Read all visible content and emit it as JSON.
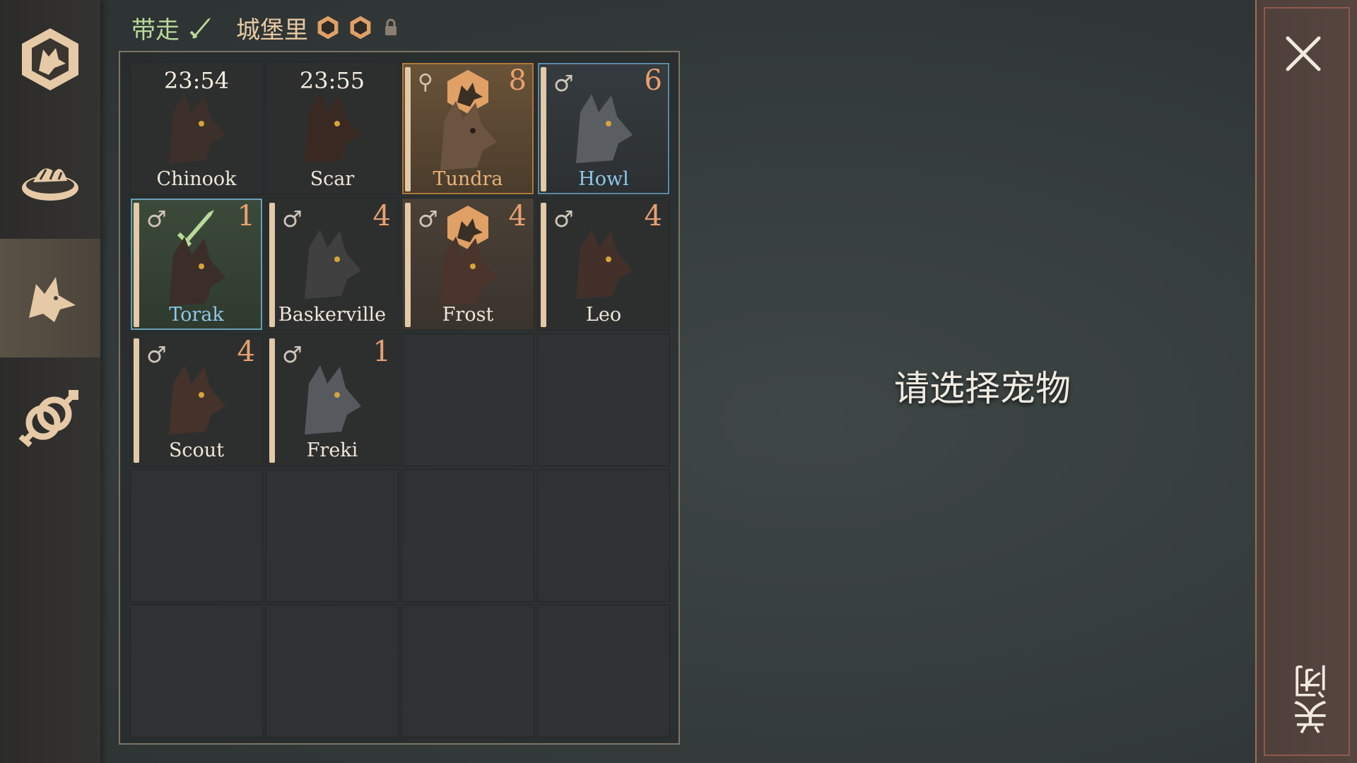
{
  "sidebar": {
    "items": [
      {
        "icon": "wolf-emblem-icon"
      },
      {
        "icon": "food-bowl-icon"
      },
      {
        "icon": "wolf-head-icon",
        "active": true
      },
      {
        "icon": "breeding-gender-icon"
      }
    ]
  },
  "tabs": {
    "takeaway_label": "带走",
    "castle_label": "城堡里"
  },
  "pets": [
    {
      "name": "Chinook",
      "time": "23:54"
    },
    {
      "name": "Scar",
      "time": "23:55"
    },
    {
      "name": "Tundra",
      "level": "8"
    },
    {
      "name": "Howl",
      "level": "6"
    },
    {
      "name": "Torak",
      "level": "1"
    },
    {
      "name": "Baskerville",
      "level": "4"
    },
    {
      "name": "Frost",
      "level": "4"
    },
    {
      "name": "Leo",
      "level": "4"
    },
    {
      "name": "Scout",
      "level": "4"
    },
    {
      "name": "Freki",
      "level": "1"
    }
  ],
  "gender_symbol": "♂",
  "prompt": "请选择宠物",
  "close": {
    "label": "关闭"
  },
  "colors": {
    "accent_gold": "#eab37a",
    "accent_blue": "#8fc7e8",
    "level_orange": "#e8a070",
    "takeaway_green": "#b9d99a"
  }
}
